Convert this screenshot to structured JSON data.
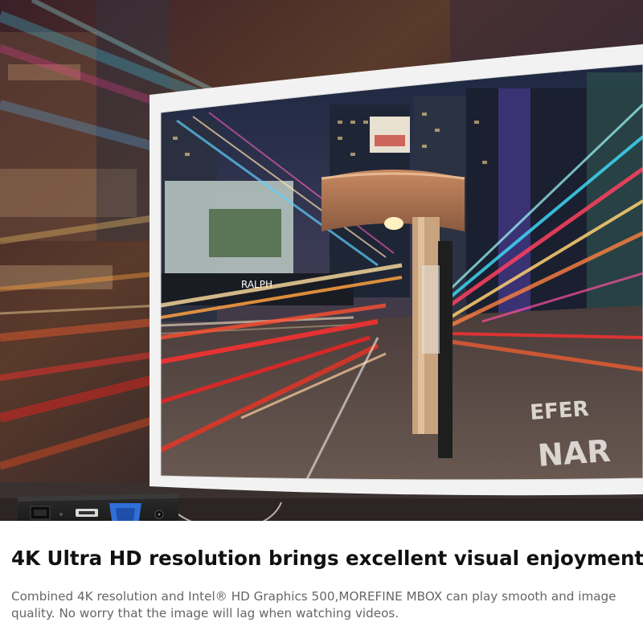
{
  "hero": {
    "scene": "curved-monitor-with-mini-pc",
    "colors": {
      "streak_red": "#ff3030",
      "streak_orange": "#ffa040",
      "streak_cyan": "#40e0ff",
      "monitor_bezel": "#f2f2f2",
      "device_body": "#1c1c1c",
      "vga_port": "#2f6fd8"
    },
    "screen_sign_text": "RALPH",
    "road_marking_1": "EFER",
    "road_marking_2": "NAR",
    "ports": [
      "ethernet-port",
      "hdmi-port",
      "vga-port",
      "power-port"
    ]
  },
  "text": {
    "headline": "4K Ultra HD resolution brings excellent visual enjoyment",
    "body": "Combined 4K resolution and Intel® HD Graphics 500,MOREFINE MBOX can play smooth and image quality. No worry that the image will lag when watching videos."
  }
}
